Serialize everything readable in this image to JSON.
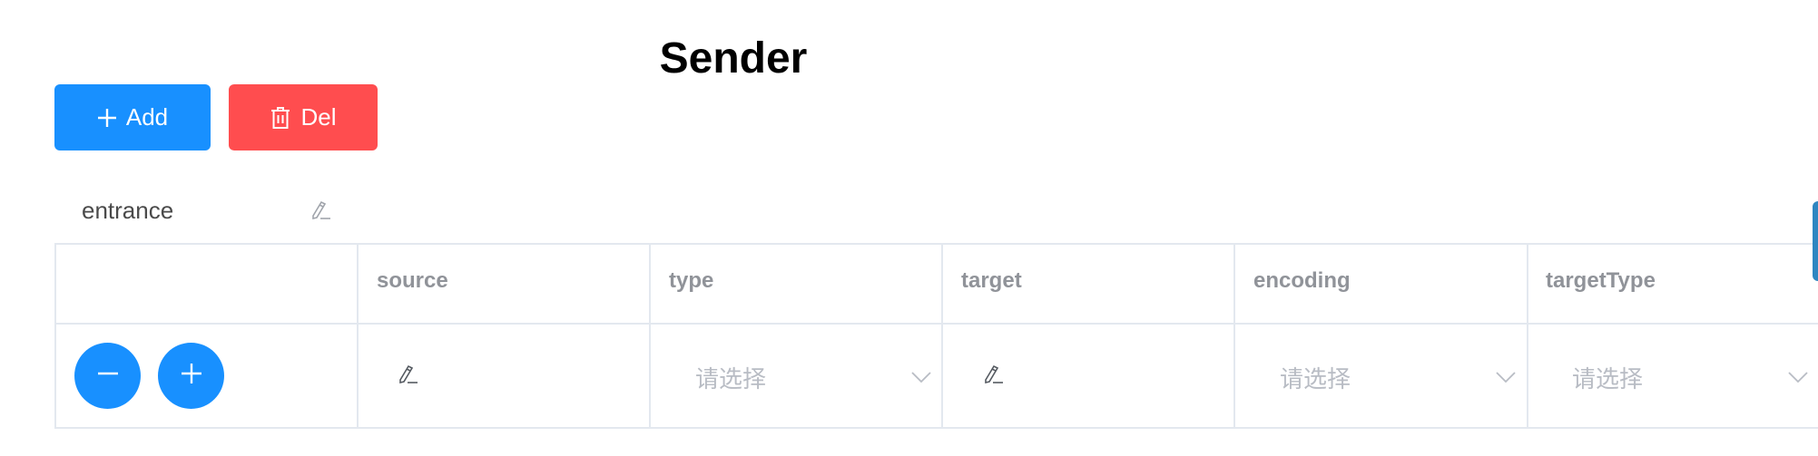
{
  "page": {
    "title": "Sender"
  },
  "toolbar": {
    "add_label": "Add",
    "del_label": "Del",
    "add_icon": "plus-icon",
    "del_icon": "trash-icon",
    "add_color": "#1890ff",
    "del_color": "#ff4d4f"
  },
  "entrance": {
    "label": "entrance",
    "icon": "pencil-icon"
  },
  "table": {
    "columns": [
      "",
      "source",
      "type",
      "target",
      "encoding",
      "targetType"
    ],
    "rows": [
      {
        "actions": [
          "minus-icon",
          "plus-icon"
        ],
        "source": {
          "kind": "editable",
          "icon": "pencil-icon"
        },
        "type": {
          "kind": "select",
          "placeholder": "请选择"
        },
        "target": {
          "kind": "editable",
          "icon": "pencil-icon"
        },
        "encoding": {
          "kind": "select",
          "placeholder": "请选择"
        },
        "targetType": {
          "kind": "select",
          "placeholder": "请选择"
        }
      }
    ]
  },
  "colors": {
    "accent": "#1890ff",
    "danger": "#ff4d4f",
    "border": "#e3e8ef",
    "header_text": "#909399",
    "placeholder_text": "#b8bcc4"
  }
}
